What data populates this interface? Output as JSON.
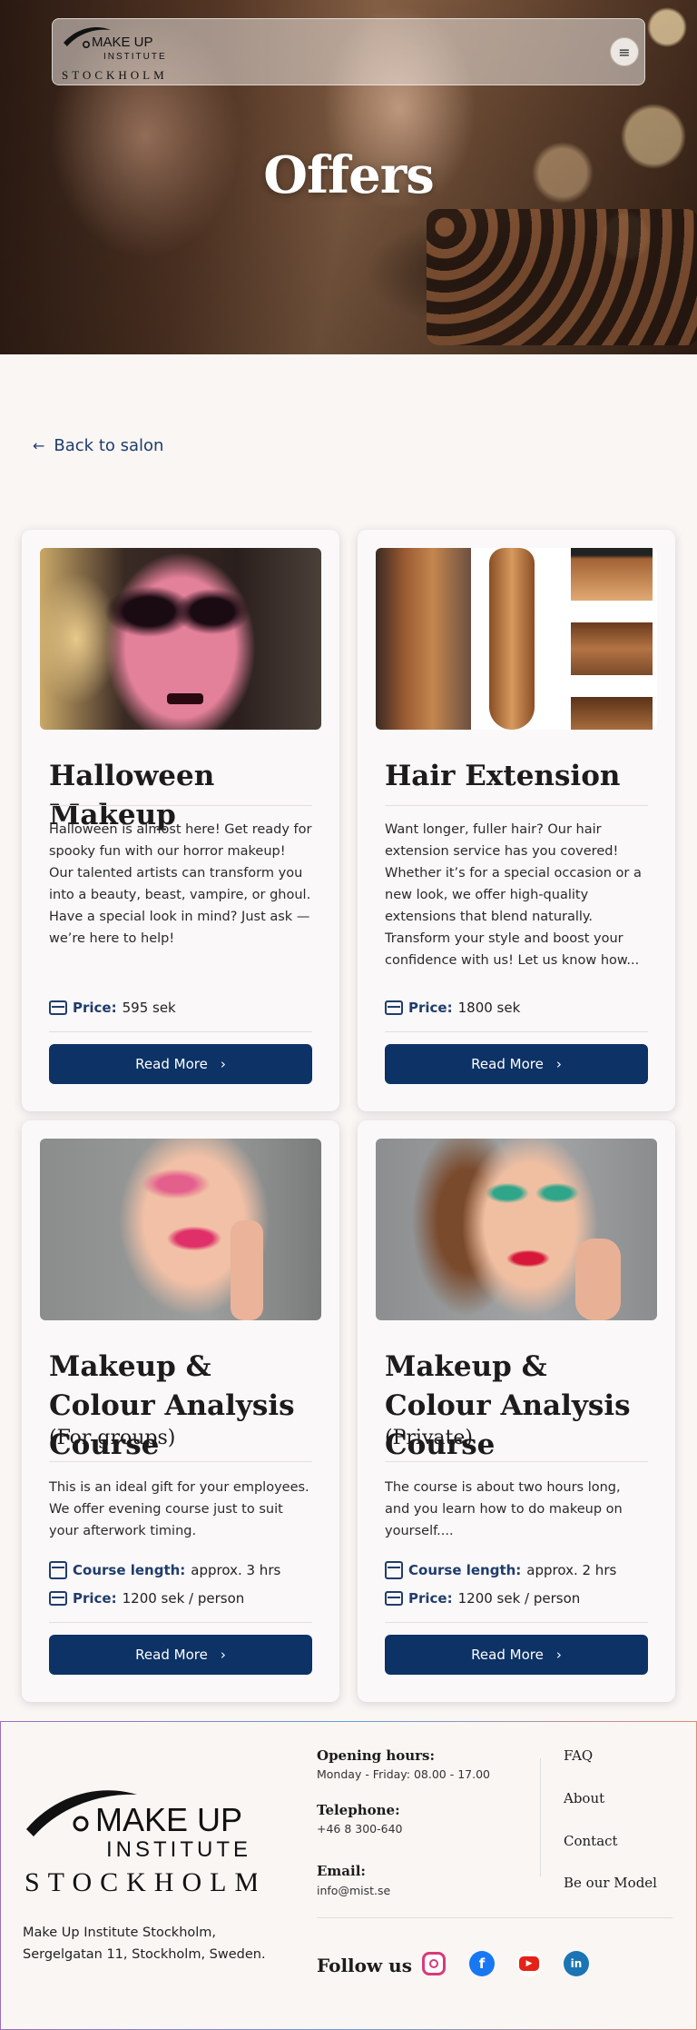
{
  "header": {
    "logo": {
      "line1": "MAKE UP",
      "line2": "INSTITUTE",
      "line3": "STOCKHOLM"
    },
    "menu_icon": "hamburger-icon",
    "title": "Offers"
  },
  "back_link": {
    "label": "Back to salon",
    "icon": "arrow-left-icon"
  },
  "offers": [
    {
      "title": "Halloween Makeup",
      "subtitle": "",
      "description": "Halloween is almost here! Get ready for spooky fun with our horror makeup! Our talented artists can transform you into a beauty, beast, vampire, or ghoul. Have a special look in mind? Just ask — we’re here to help!",
      "price_label": "Price:",
      "price": "595 sek",
      "button": "Read More"
    },
    {
      "title": "Hair Extension",
      "subtitle": "",
      "description": "Want longer, fuller hair? Our hair extension service has you covered! Whether it’s for a special occasion or a new look, we offer high-quality extensions that blend naturally. Transform your style and boost your confidence with us! Let us know how...",
      "price_label": "Price:",
      "price": "1800 sek",
      "button": "Read More"
    },
    {
      "title": "Makeup & Colour Analysis Course",
      "subtitle": "(For groups)",
      "description": "This is an ideal gift for your employees. We offer evening course just to suit your afterwork timing.",
      "length_label": "Course length:",
      "length": "approx.  3 hrs",
      "price_label": "Price:",
      "price": "1200 sek / person",
      "button": "Read More"
    },
    {
      "title": "Makeup & Colour Analysis Course",
      "subtitle": "(Private)",
      "description": "The course is about two hours long, and you learn how to do makeup on yourself....",
      "length_label": "Course length:",
      "length": "approx.  2 hrs",
      "price_label": "Price:",
      "price": "1200 sek / person",
      "button": "Read More"
    }
  ],
  "footer": {
    "logo": {
      "line1": "MAKE UP",
      "line2": "INSTITUTE",
      "line3": "STOCKHOLM"
    },
    "address_line1": "Make Up Institute Stockholm,",
    "address_line2": "Sergelgatan 11, Stockholm, Sweden.",
    "hours_title": "Opening hours:",
    "hours_value": "Monday - Friday: 08.00  - 17.00",
    "phone_title": "Telephone:",
    "phone_value": "+46 8 300-640",
    "email_title": "Email:",
    "email_value": "info@mist.se",
    "links": [
      "FAQ",
      "About",
      "Contact",
      "Be our Model"
    ],
    "follow": "Follow us",
    "social": [
      "instagram-icon",
      "facebook-icon",
      "youtube-icon",
      "linkedin-icon"
    ]
  },
  "colors": {
    "primary": "#0c3266",
    "accent_text": "#1f3d6b",
    "background": "#faf6f4"
  }
}
